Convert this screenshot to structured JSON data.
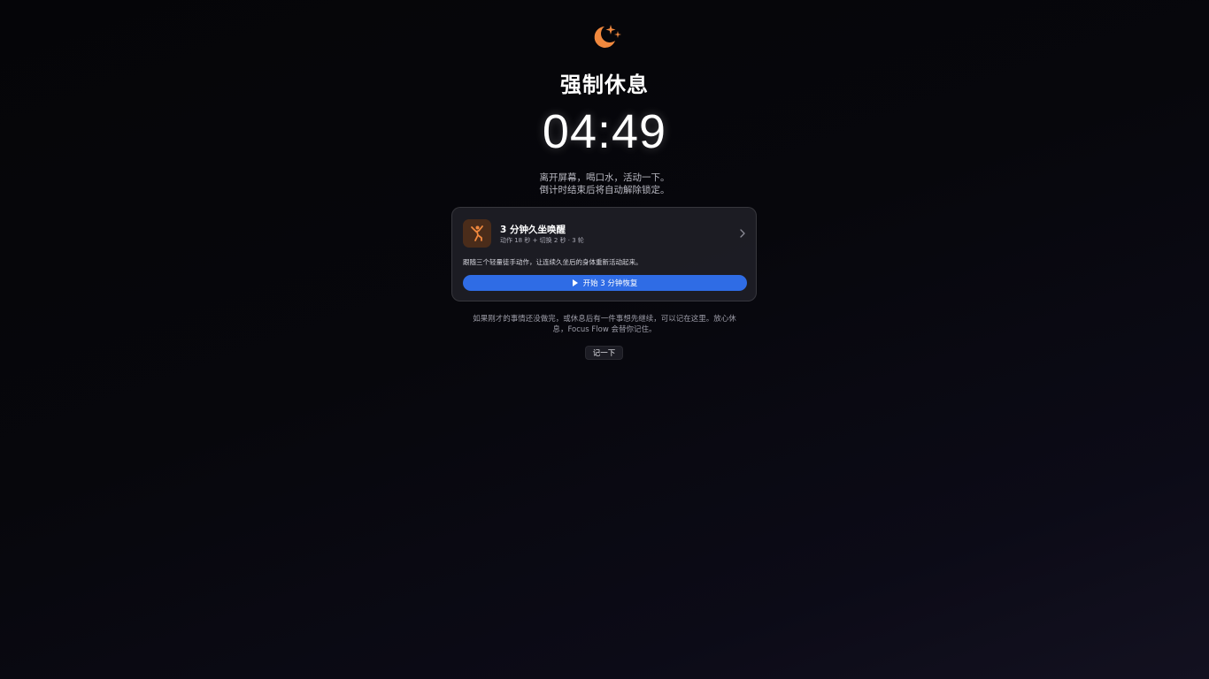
{
  "app": {
    "icon": "moon-stars-icon",
    "accent_color": "#f0883e",
    "button_color": "#2f6ce5"
  },
  "header": {
    "title": "强制休息",
    "timer": "04:49"
  },
  "message": {
    "line1": "离开屏幕，喝口水，活动一下。",
    "line2": "倒计时结束后将自动解除锁定。"
  },
  "exercise_card": {
    "icon": "stretch-person-icon",
    "title": "3 分钟久坐唤醒",
    "meta": "动作 18 秒 + 切换 2 秒 · 3 轮",
    "description": "跟随三个轻量徒手动作，让连续久坐后的身体重新活动起来。",
    "start_label": "开始 3 分钟恢复"
  },
  "note": {
    "text": "如果刚才的事情还没做完，或休息后有一件事想先继续，可以记在这里。放心休息，Focus Flow 会替你记住。",
    "button_label": "记一下"
  }
}
